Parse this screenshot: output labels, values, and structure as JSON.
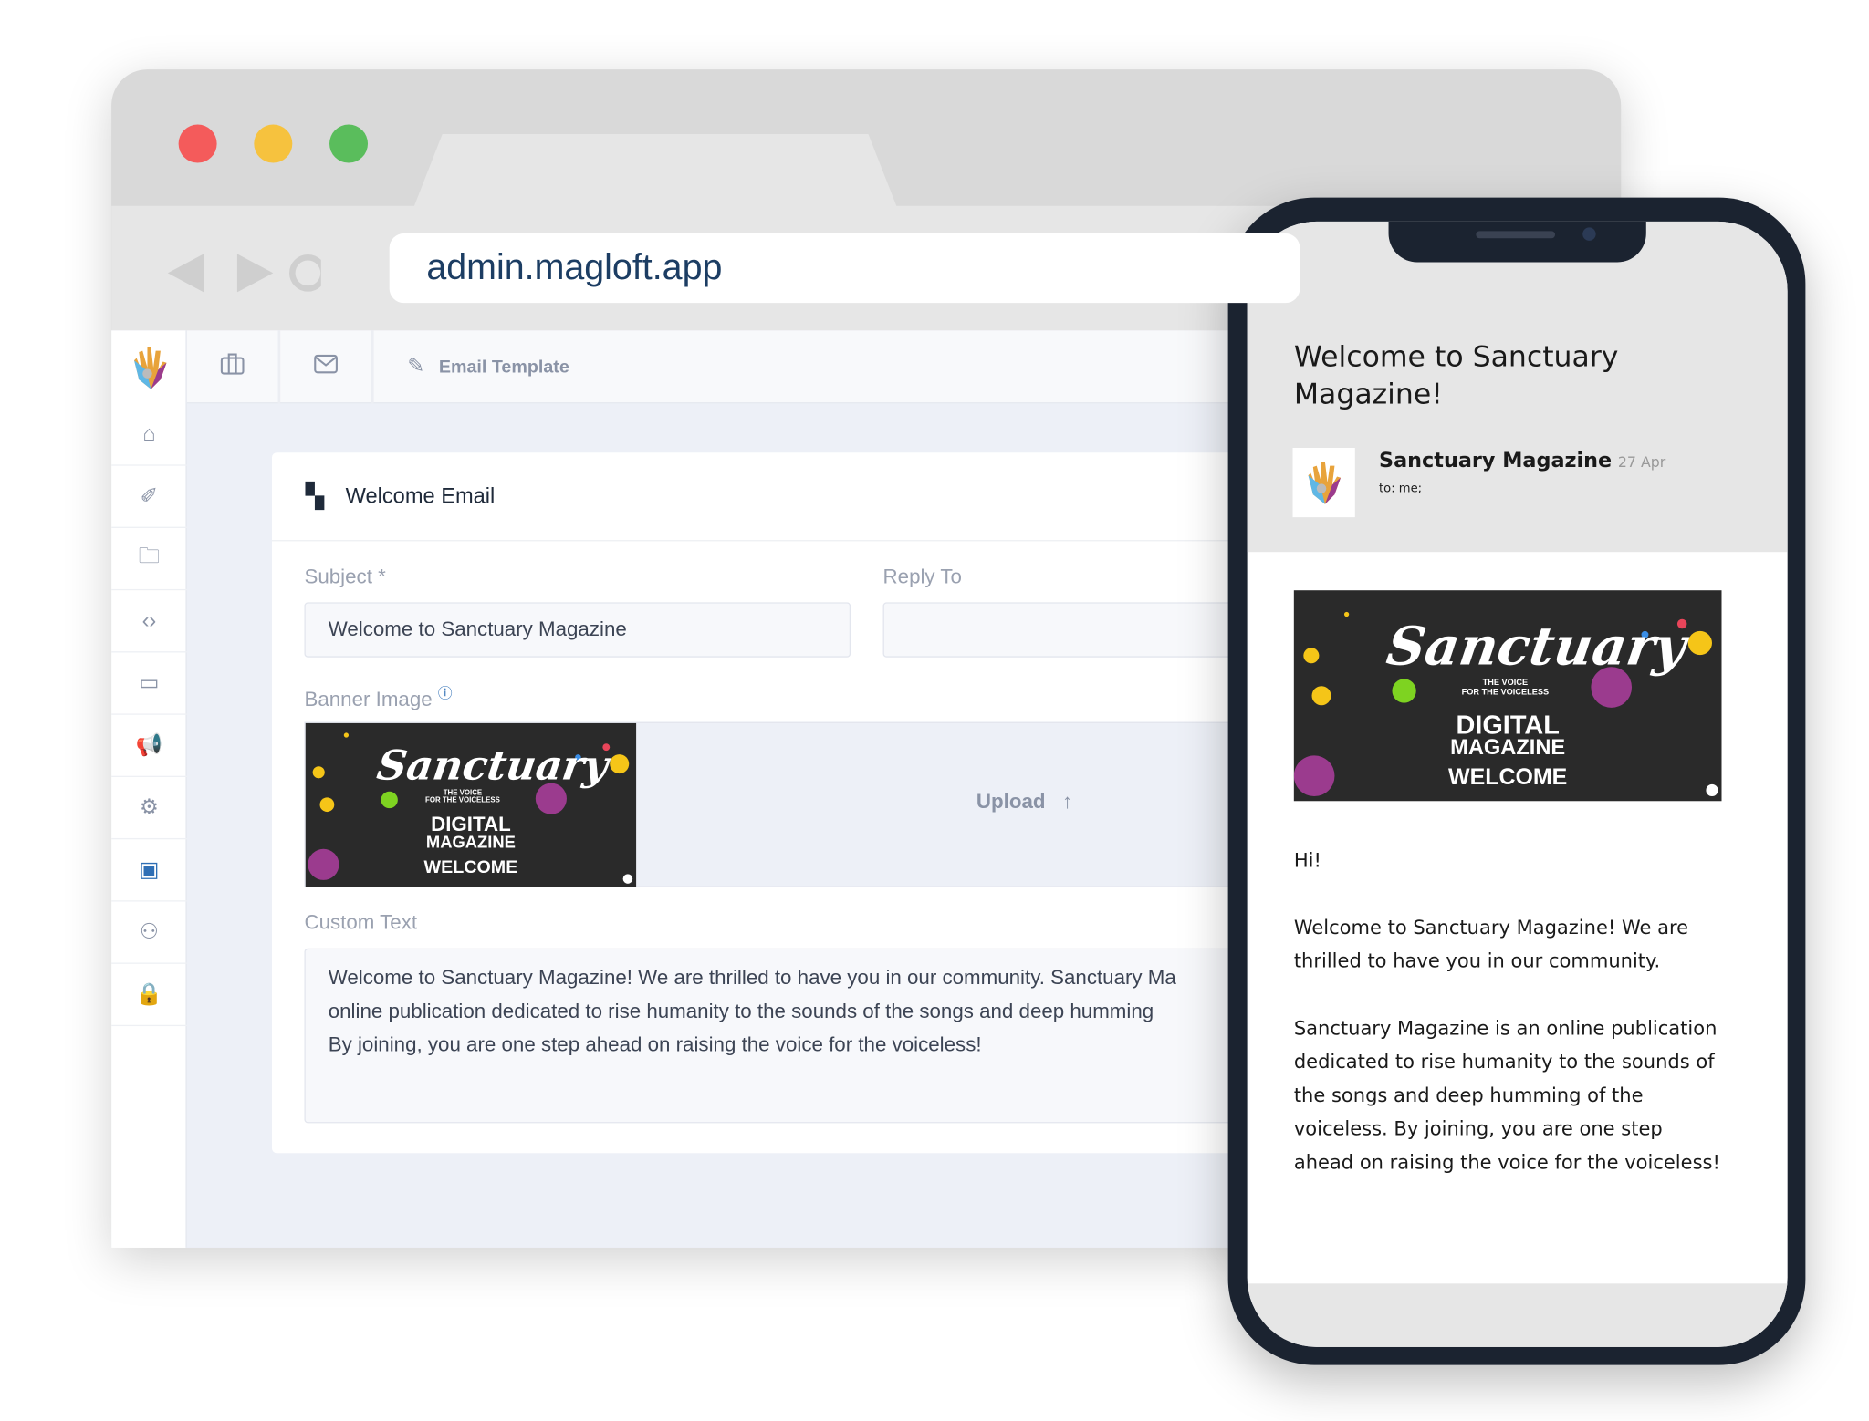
{
  "browser": {
    "url": "admin.magloft.app",
    "traffic_lights": {
      "close": "#f45b5b",
      "minimize": "#f6c23e",
      "maximize": "#5abd5c"
    }
  },
  "sidebar": {
    "items": [
      {
        "icon": "home-icon"
      },
      {
        "icon": "brush-icon"
      },
      {
        "icon": "folder-icon"
      },
      {
        "icon": "code-icon"
      },
      {
        "icon": "chat-icon"
      },
      {
        "icon": "megaphone-icon"
      },
      {
        "icon": "settings-icon"
      },
      {
        "icon": "briefcase-icon",
        "active": true
      },
      {
        "icon": "users-icon"
      },
      {
        "icon": "lock-icon"
      }
    ],
    "active_color": "#2f6fb5"
  },
  "breadcrumb": {
    "current": "Email Template"
  },
  "card": {
    "title": "Welcome Email",
    "subject_label": "Subject *",
    "subject_value": "Welcome to Sanctuary Magazine",
    "reply_to_label": "Reply To",
    "reply_to_value": "",
    "banner_label": "Banner Image",
    "upload_label": "Upload",
    "custom_text_label": "Custom Text",
    "custom_text_lines": [
      "Welcome to Sanctuary Magazine! We are thrilled to have you in our community. Sanctuary Ma",
      "online publication dedicated to rise humanity to the sounds of the songs and deep humming",
      "By joining, you are one step ahead on raising the voice for the voiceless!"
    ]
  },
  "banner": {
    "logo": "Sanctuary",
    "tagline1": "THE VOICE",
    "tagline2": "FOR THE VOICELESS",
    "line1": "DIGITAL",
    "line2": "MAGAZINE",
    "line3": "WELCOME"
  },
  "phone": {
    "subject": "Welcome to Sanctuary Magazine!",
    "sender": "Sanctuary Magazine",
    "date": "27 Apr",
    "to": "to: me;",
    "greeting": "Hi!",
    "para1": "Welcome to Sanctuary Magazine! We are thrilled to have you in our community.",
    "para2": "Sanctuary Magazine is an online publication dedicated to rise humanity to the sounds of the songs and deep humming of the voiceless. By joining, you are one step ahead on raising the voice for the voiceless!"
  }
}
